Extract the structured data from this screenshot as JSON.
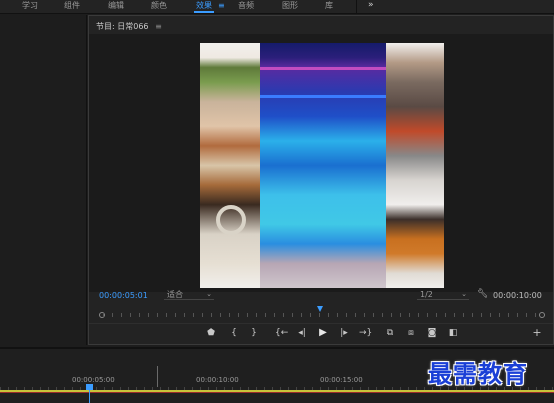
{
  "workspace_tabs": [
    {
      "label": "学习"
    },
    {
      "label": "组件"
    },
    {
      "label": "编辑"
    },
    {
      "label": "颜色"
    },
    {
      "label": "效果"
    },
    {
      "label": "音频"
    },
    {
      "label": "图形"
    },
    {
      "label": "库"
    }
  ],
  "workspace": {
    "active_tab": "效果",
    "menu_glyph": "≡",
    "overflow_glyph": "»",
    "accent_color": "#3b9cff"
  },
  "program_monitor": {
    "title": "节目: 日常066",
    "title_menu": "≡",
    "current_timecode": "00:00:05:01",
    "fit_value": "适合",
    "quality_value": "1/2",
    "duration_timecode": "00:00:10:00",
    "settings_icon": "wrench-icon"
  },
  "transport": {
    "marker_icon": "marker-icon",
    "mark_in_glyph": "{",
    "mark_out_glyph": "}",
    "go_to_in_glyph": "{←",
    "step_back_glyph": "◂|",
    "play_glyph": "▶",
    "step_forward_glyph": "|▸",
    "go_to_out_glyph": "→}",
    "add_glyph": "+"
  },
  "timeline": {
    "ruler_labels": [
      "00:00:05:00",
      "00:00:10:00",
      "00:00:15:00"
    ],
    "playhead_color": "#3b9cff",
    "work_area_color": "#c7c33a"
  },
  "watermark": {
    "text": "最需教育",
    "color": "#1a3fd6"
  }
}
